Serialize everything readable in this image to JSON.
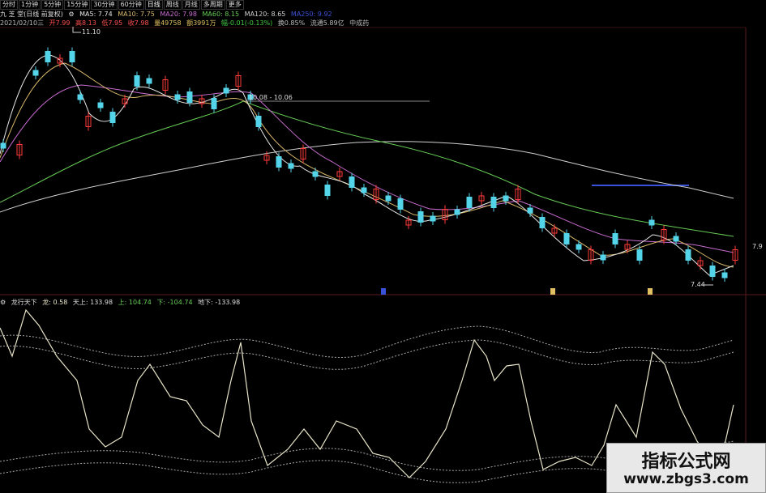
{
  "toolbar": {
    "items": [
      "分时",
      "1分钟",
      "5分钟",
      "15分钟",
      "30分钟",
      "60分钟",
      "日线",
      "周线",
      "月线",
      "多周期",
      "更多"
    ]
  },
  "ma_line": {
    "stock": "九 芝 堂(日线 前复权)",
    "ma5": "MA5: 7.74",
    "ma10": "MA10: 7.75",
    "ma20": "MA20: 7.98",
    "ma60": "MA60: 8.15",
    "ma120": "MA120: 8.65",
    "extra": "MA250: 9.92"
  },
  "info_line": {
    "date": "2021/02/10三",
    "open": "开7.99",
    "high": "高8.13",
    "low": "低7.95",
    "close": "收7.98",
    "volume": "量49758",
    "amount": "额3991万",
    "change": "幅-0.01(-0.13%)",
    "turnover": "换0.85%",
    "float": "流通5.89亿",
    "industry": "中成药"
  },
  "annotations": {
    "high_price": "11.10",
    "range": "10.08 - 10.06",
    "low_price": "7.44",
    "right_price": "7.9"
  },
  "indicator": {
    "name": "龙行天下",
    "dragon": "龙: 0.58",
    "sky": "天上: 133.98",
    "up": "上: 104.74",
    "down": "下: -104.74",
    "ground": "地下: -133.98"
  },
  "watermark": {
    "title": "指标公式网",
    "url": "www.zbgs3.com"
  },
  "colors": {
    "up": "#ff3b3b",
    "down": "#54d4e8",
    "ma5": "#e8e8e8",
    "ma10": "#d8b86a",
    "ma20": "#c86bd0",
    "ma60": "#66cc55",
    "ma120": "#d0d0d0",
    "indicator": "#e8e4c8"
  }
}
